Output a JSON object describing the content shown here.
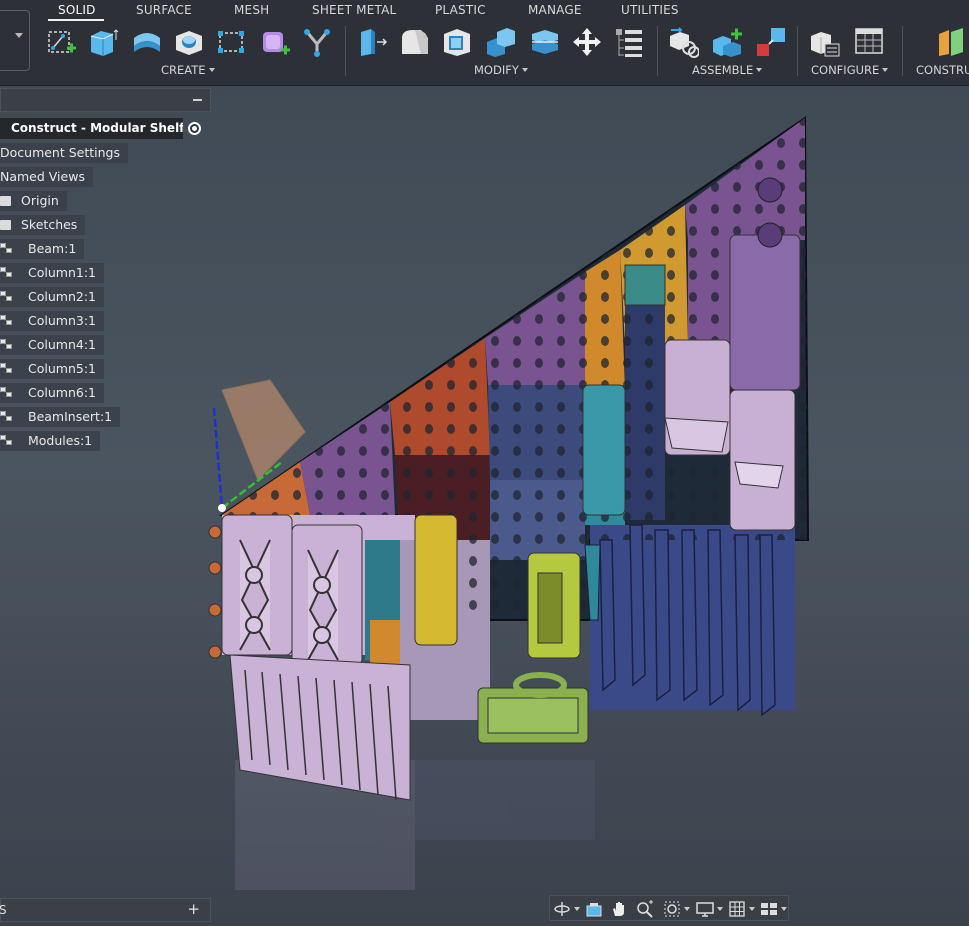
{
  "toolbar": {
    "tabs": [
      "SOLID",
      "SURFACE",
      "MESH",
      "SHEET METAL",
      "PLASTIC",
      "MANAGE",
      "UTILITIES"
    ],
    "groups": [
      "CREATE",
      "MODIFY",
      "ASSEMBLE",
      "CONFIGURE",
      "CONSTRU"
    ],
    "accent": "#2ea8e6"
  },
  "browser": {
    "document": "Construct - Modular Shelf v...",
    "items": [
      "Document Settings",
      "Named Views",
      "Origin",
      "Sketches",
      "Beam:1",
      "Column1:1",
      "Column2:1",
      "Column3:1",
      "Column4:1",
      "Column5:1",
      "Column6:1",
      "BeamInsert:1",
      "Modules:1"
    ]
  },
  "bottom": {
    "comments_label": "S",
    "add_label": "+"
  },
  "icons": [
    "sketch-icon",
    "box-icon",
    "extrude-icon",
    "hole-icon",
    "rectangle-pattern-icon",
    "combine-icon",
    "fork-icon",
    "press-pull-icon",
    "fillet-icon",
    "shell-icon",
    "combine-bodies-icon",
    "align-icon",
    "move-icon",
    "parameters-icon",
    "joint-icon",
    "new-component-icon",
    "as-built-icon",
    "configure-icon",
    "table-icon",
    "plane-icon",
    "orbit-icon",
    "look-at-icon",
    "pan-icon",
    "zoom-icon",
    "fit-icon",
    "display-icon",
    "grid-icon",
    "viewports-icon"
  ]
}
